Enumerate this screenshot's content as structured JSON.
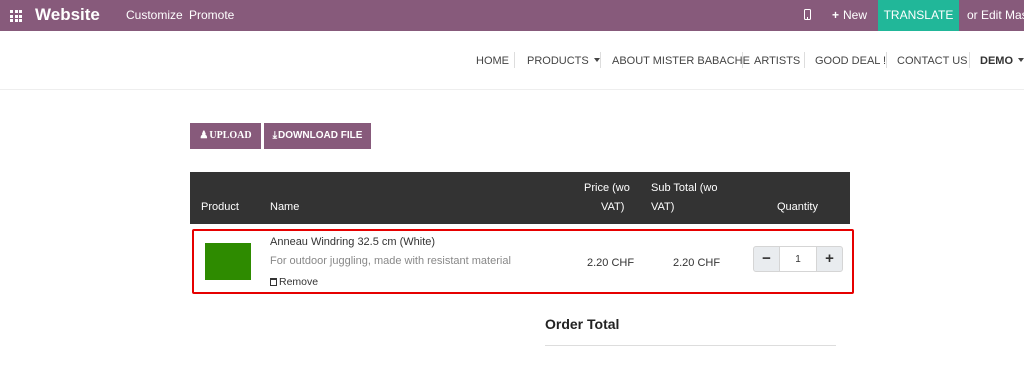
{
  "topbar": {
    "brand": "Website",
    "links": [
      "Customize",
      "Promote"
    ],
    "new_label": "New",
    "translate_label": "TRANSLATE",
    "edit_master_label": "or Edit Maste",
    "bg_color": "#875a7b",
    "translate_color": "#21b799"
  },
  "nav": {
    "items": [
      "HOME",
      "PRODUCTS",
      "ABOUT MISTER BABACHE",
      "ARTISTS",
      "GOOD DEAL !",
      "CONTACT US",
      "DEMO"
    ]
  },
  "actions": {
    "upload_label": "UPLOAD",
    "download_label": "DOWNLOAD FILE"
  },
  "cart": {
    "headers": {
      "product": "Product",
      "name": "Name",
      "price_line1": "Price (wo",
      "price_line2": "VAT)",
      "subtotal_line1": "Sub Total (wo",
      "subtotal_line2": "VAT)",
      "quantity": "Quantity"
    },
    "line": {
      "name": "Anneau Windring 32.5 cm (White)",
      "description": "For outdoor juggling, made with resistant material",
      "remove_label": "Remove",
      "price": "2.20 CHF",
      "subtotal": "2.20 CHF",
      "quantity": "1",
      "thumbnail_color": "#2e8b00"
    },
    "highlight_color": "#e60000"
  },
  "order_total": {
    "title": "Order Total"
  }
}
